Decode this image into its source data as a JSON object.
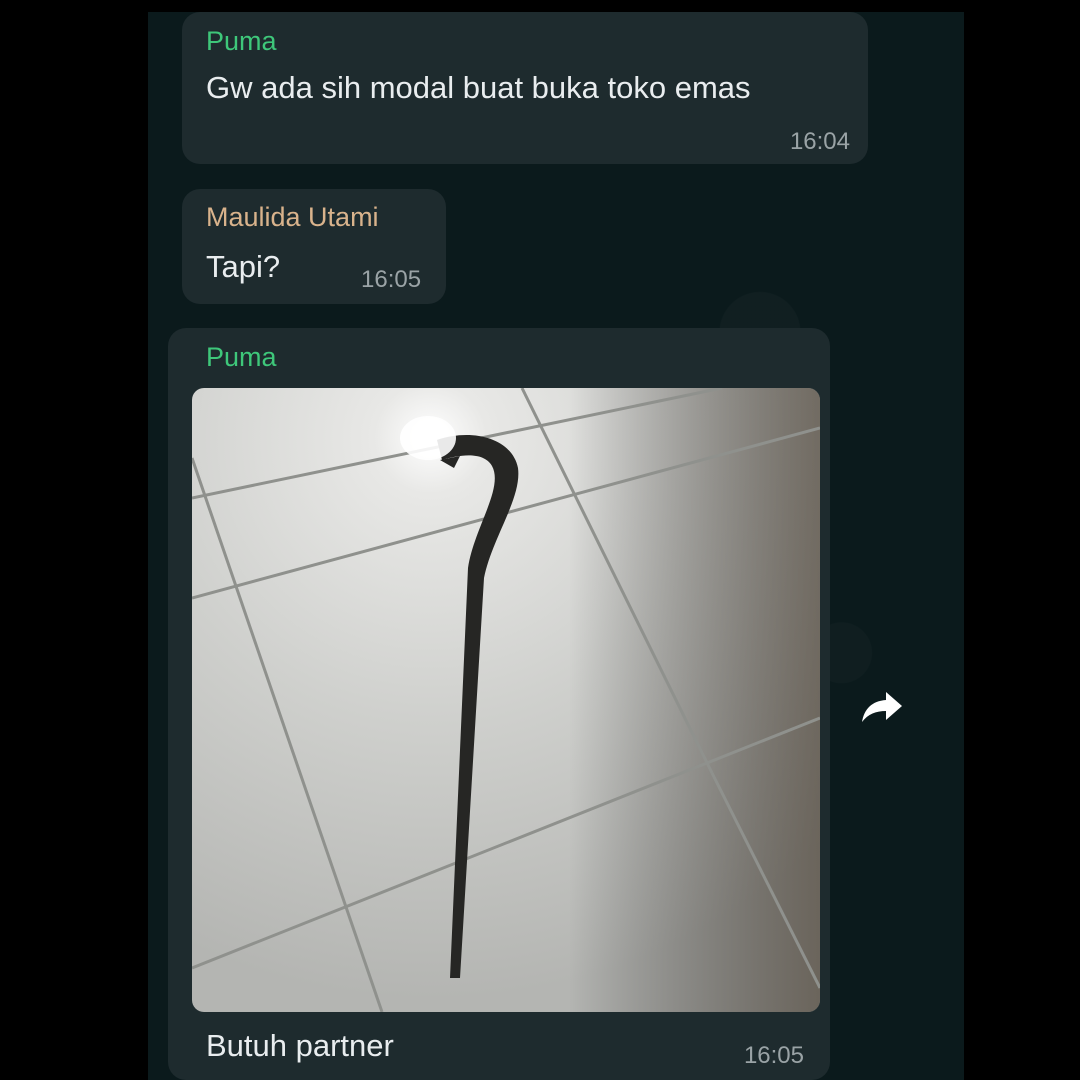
{
  "messages": [
    {
      "sender": "Puma",
      "sender_color": "#3ec77a",
      "text": "Gw ada sih modal buat buka toko emas",
      "time": "16:04"
    },
    {
      "sender": "Maulida Utami",
      "sender_color": "#d9b38c",
      "text": "Tapi?",
      "time": "16:05"
    },
    {
      "sender": "Puma",
      "sender_color": "#3ec77a",
      "caption": "Butuh partner",
      "time": "16:05",
      "has_image": true
    }
  ],
  "icons": {
    "forward": "forward-arrow-icon"
  },
  "colors": {
    "bubble": "#1e2b2e",
    "chat_bg": "#0b1a1c"
  }
}
